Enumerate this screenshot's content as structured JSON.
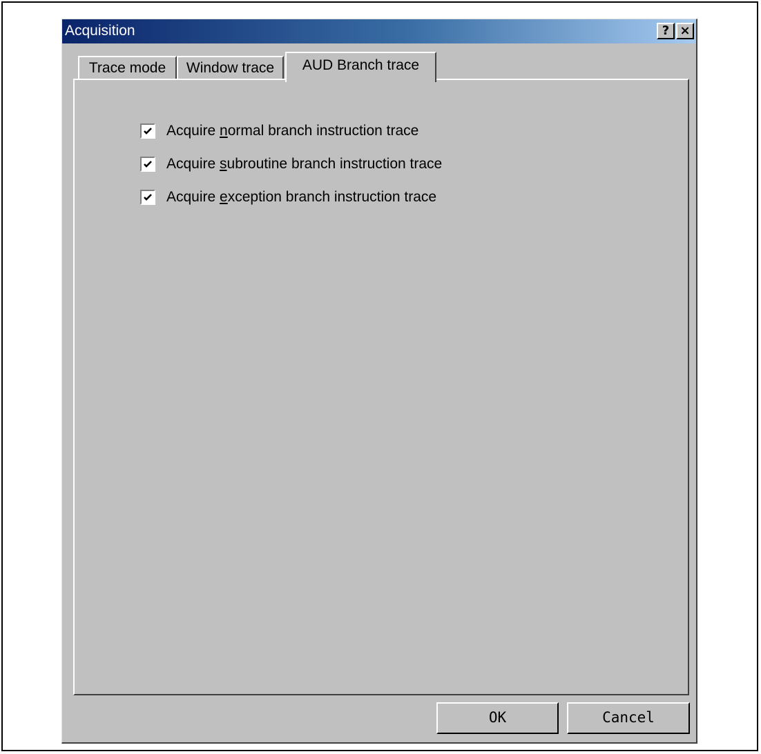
{
  "window": {
    "title": "Acquisition",
    "help_button": "?",
    "close_button": "×"
  },
  "tabs": [
    {
      "label": "Trace mode",
      "active": false
    },
    {
      "label": "Window trace",
      "active": false
    },
    {
      "label": "AUD Branch trace",
      "active": true
    }
  ],
  "checkboxes": [
    {
      "pre": "Acquire ",
      "mnemonic": "n",
      "post": "ormal branch instruction trace",
      "checked": true
    },
    {
      "pre": "Acquire ",
      "mnemonic": "s",
      "post": "ubroutine branch instruction trace",
      "checked": true
    },
    {
      "pre": "Acquire ",
      "mnemonic": "e",
      "post": "xception branch instruction trace",
      "checked": true
    }
  ],
  "buttons": {
    "ok": "OK",
    "cancel": "Cancel"
  }
}
